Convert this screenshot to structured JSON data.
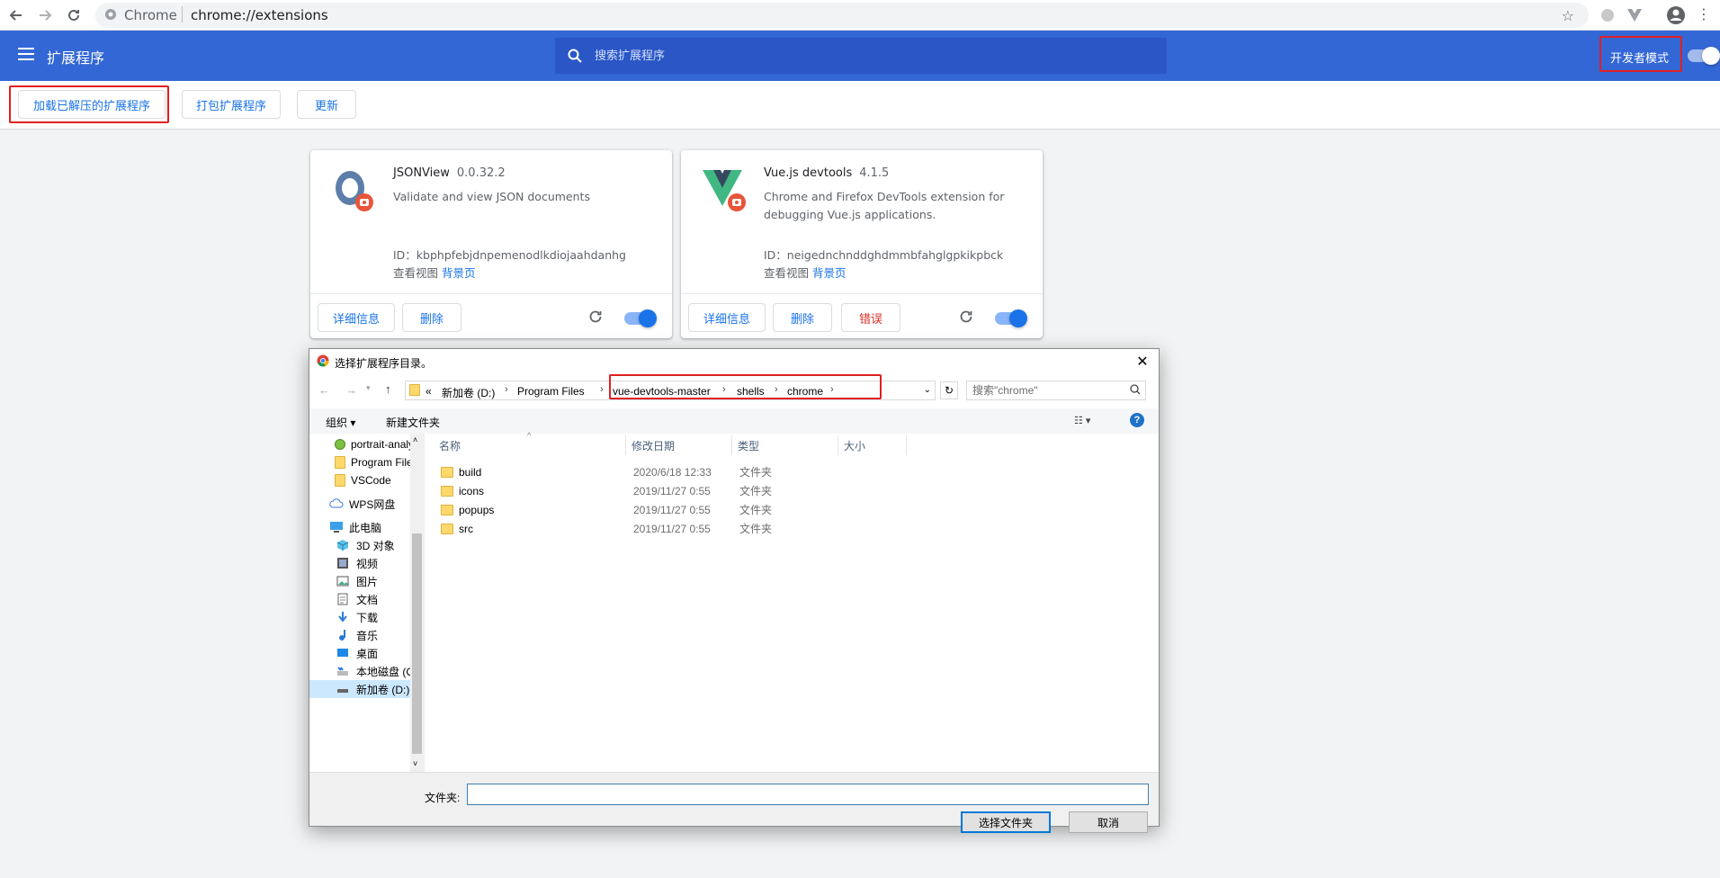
{
  "browser": {
    "site_label": "Chrome",
    "url": "chrome://extensions"
  },
  "header": {
    "title": "扩展程序",
    "search_placeholder": "搜索扩展程序",
    "dev_mode_label": "开发者模式"
  },
  "toolbar": {
    "load_unpacked": "加载已解压的扩展程序",
    "pack": "打包扩展程序",
    "update": "更新"
  },
  "extensions": [
    {
      "name": "JSONView",
      "version": "0.0.32.2",
      "description": "Validate and view JSON documents",
      "id_text": "ID：kbphpfebjdnpemenodlkdiojaahdanhg",
      "views_label": "查看视图",
      "views_link": "背景页",
      "details": "详细信息",
      "remove": "删除",
      "enabled": true
    },
    {
      "name": "Vue.js devtools",
      "version": "4.1.5",
      "description": "Chrome and Firefox DevTools extension for debugging Vue.js applications.",
      "id_text": "ID：neigednchnddghdmmbfahglgpkikpbck",
      "views_label": "查看视图",
      "views_link": "背景页",
      "details": "详细信息",
      "remove": "删除",
      "errors": "错误",
      "enabled": true
    }
  ],
  "dialog": {
    "title": "选择扩展程序目录。",
    "breadcrumbs": [
      "«",
      "新加卷 (D:)",
      "Program Files",
      "vue-devtools-master",
      "shells",
      "chrome"
    ],
    "search_placeholder": "搜索\"chrome\"",
    "organize": "组织 ▾",
    "new_folder": "新建文件夹",
    "nav_items": [
      "portrait-analys",
      "Program Files",
      "VSCode",
      "WPS网盘",
      "此电脑",
      "3D 对象",
      "视频",
      "图片",
      "文档",
      "下载",
      "音乐",
      "桌面",
      "本地磁盘 (C:)",
      "新加卷 (D:)"
    ],
    "columns": [
      "名称",
      "修改日期",
      "类型",
      "大小"
    ],
    "files": [
      {
        "name": "build",
        "date": "2020/6/18 12:33",
        "type": "文件夹"
      },
      {
        "name": "icons",
        "date": "2019/11/27 0:55",
        "type": "文件夹"
      },
      {
        "name": "popups",
        "date": "2019/11/27 0:55",
        "type": "文件夹"
      },
      {
        "name": "src",
        "date": "2019/11/27 0:55",
        "type": "文件夹"
      }
    ],
    "folder_label": "文件夹:",
    "folder_value": "",
    "select_button": "选择文件夹",
    "cancel_button": "取消"
  },
  "colors": {
    "header_blue": "#3367d6",
    "accent": "#1a73e8",
    "highlight_red": "#e02020"
  }
}
